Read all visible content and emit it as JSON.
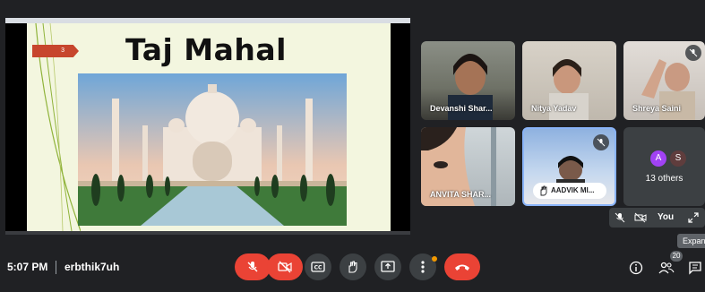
{
  "slide": {
    "number": "3",
    "title": "Taj Mahal"
  },
  "participants": [
    {
      "name": "Devanshi Shar...",
      "muted": false
    },
    {
      "name": "Nitya Yadav",
      "muted": false
    },
    {
      "name": "Shreya Saini",
      "muted": true
    },
    {
      "name": "ANVITA SHAR...",
      "muted": false
    },
    {
      "name": "AADVIK MI...",
      "muted": true,
      "hand_raised": true
    }
  ],
  "others_tile": {
    "avatars": [
      {
        "initial": "A",
        "color": "#a142f4"
      },
      {
        "initial": "S",
        "color": "#5f3d3d"
      }
    ],
    "label": "13 others"
  },
  "self_tile": {
    "label": "You"
  },
  "tooltip": "Expand",
  "meeting": {
    "time": "5:07 PM",
    "code": "erbthik7uh",
    "participant_count": "20"
  },
  "colors": {
    "end_call": "#ea4335",
    "control_bg": "#3c4043",
    "app_bg": "#202124",
    "notify_dot": "#f29900"
  },
  "icons": [
    "mic-off-icon",
    "camera-off-icon",
    "captions-icon",
    "raise-hand-icon",
    "present-icon",
    "more-options-icon",
    "end-call-icon",
    "info-icon",
    "people-icon",
    "chat-icon",
    "expand-icon"
  ]
}
